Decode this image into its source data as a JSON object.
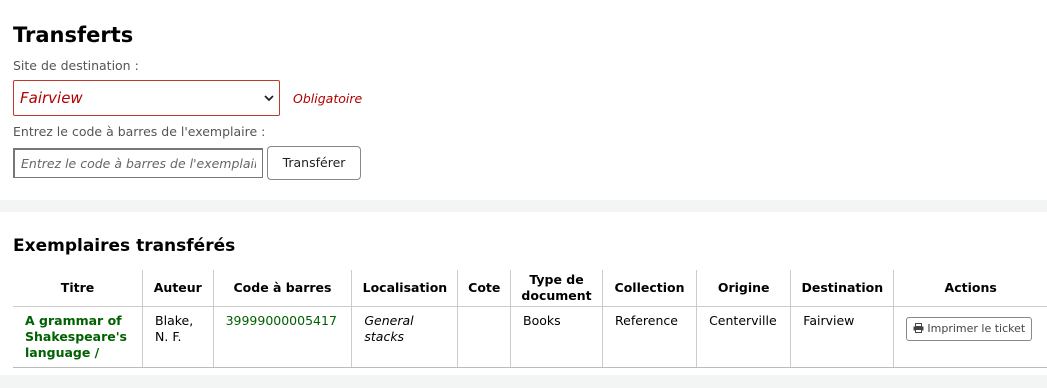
{
  "page": {
    "title": "Transferts",
    "destination_label": "Site de destination :",
    "destination_value": "Fairview",
    "required_text": "Obligatoire",
    "barcode_label": "Entrez le code à barres de l'exemplaire :",
    "barcode_placeholder": "Entrez le code à barres de l'exemplaire",
    "transfer_button": "Transférer"
  },
  "transferred": {
    "heading": "Exemplaires transférés",
    "columns": [
      "Titre",
      "Auteur",
      "Code à barres",
      "Localisation",
      "Cote",
      "Type de document",
      "Collection",
      "Origine",
      "Destination",
      "Actions"
    ],
    "rows": [
      {
        "title": "A grammar of Shakespeare's language /",
        "author": "Blake, N. F.",
        "barcode": "39999000005417",
        "location": "General stacks",
        "call_number": "",
        "item_type": "Books",
        "collection": "Reference",
        "origin": "Centerville",
        "destination": "Fairview",
        "action_label": "Imprimer le ticket"
      }
    ]
  },
  "icons": {
    "select_arrow": "chevron-down-icon",
    "print": "printer-icon"
  },
  "colors": {
    "required": "#b20000",
    "link": "#006100"
  }
}
